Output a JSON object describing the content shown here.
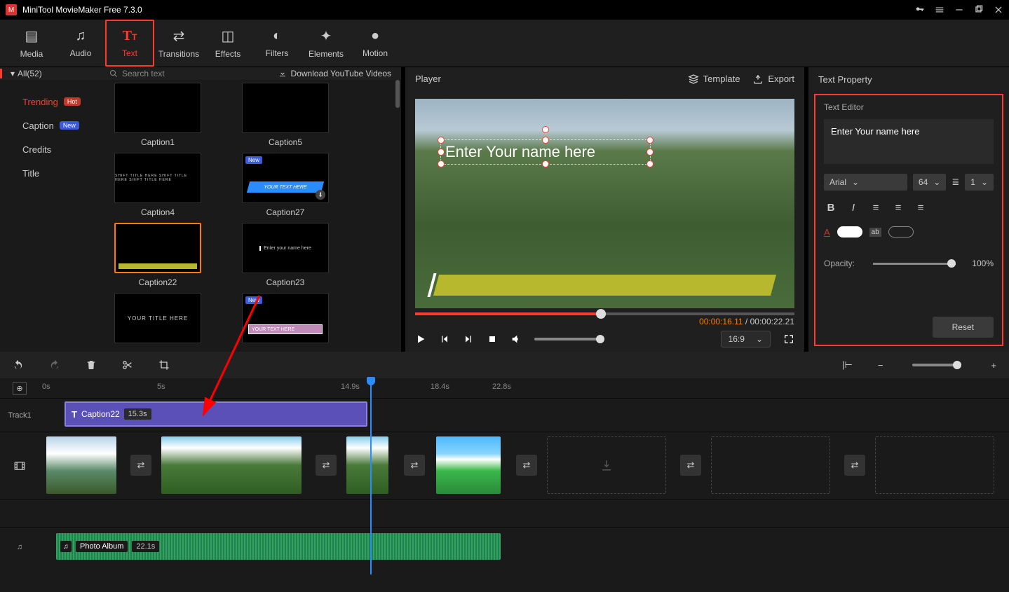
{
  "app": {
    "title": "MiniTool MovieMaker Free 7.3.0"
  },
  "ribbon": {
    "media": "Media",
    "audio": "Audio",
    "text": "Text",
    "transitions": "Transitions",
    "effects": "Effects",
    "filters": "Filters",
    "elements": "Elements",
    "motion": "Motion"
  },
  "browser": {
    "all_label": "All(52)",
    "search_placeholder": "Search text",
    "download_label": "Download YouTube Videos",
    "categories": {
      "trending": "Trending",
      "trending_badge": "Hot",
      "caption": "Caption",
      "caption_badge": "New",
      "credits": "Credits",
      "title": "Title"
    },
    "thumbs": {
      "caption1": "Caption1",
      "caption5": "Caption5",
      "caption4": "Caption4",
      "caption27": "Caption27",
      "caption22": "Caption22",
      "caption23": "Caption23",
      "caption27_preview": "YOUR TEXT HERE",
      "caption23_preview": "Enter your name here",
      "thumb_title_preview": "YOUR TITLE HERE",
      "thumb_text_preview": "YOUR TEXT HERE",
      "new_badge": "New"
    }
  },
  "player": {
    "label": "Player",
    "template_btn": "Template",
    "export_btn": "Export",
    "overlay_text": "Enter Your name here",
    "time_current": "00:00:16.11",
    "time_sep": " / ",
    "time_total": "00:00:22.21",
    "aspect": "16:9"
  },
  "text_property": {
    "panel_title": "Text Property",
    "editor_label": "Text Editor",
    "text_value": "Enter Your name here",
    "font_family": "Arial",
    "font_size": "64",
    "line_count": "1",
    "opacity_label": "Opacity:",
    "opacity_value": "100%",
    "reset_label": "Reset"
  },
  "timeline": {
    "ruler": {
      "t0": "0s",
      "t1": "5s",
      "t2": "14.9s",
      "t3": "18.4s",
      "t4": "22.8s"
    },
    "track1_label": "Track1",
    "text_clip": {
      "name": "Caption22",
      "duration": "15.3s"
    },
    "audio_clip": {
      "name": "Photo Album",
      "duration": "22.1s"
    }
  }
}
